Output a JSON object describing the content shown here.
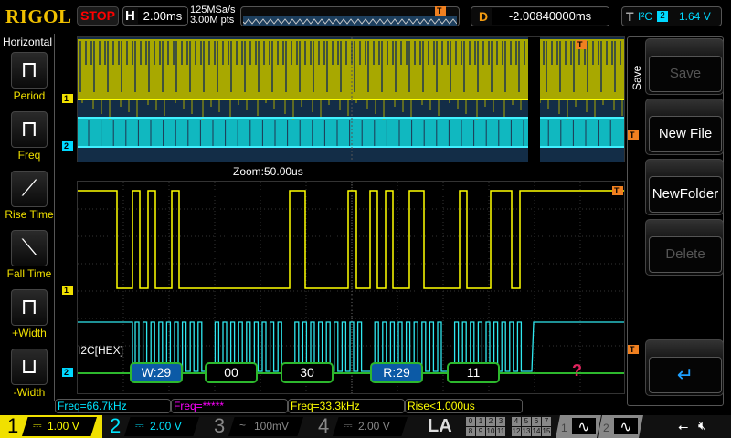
{
  "header": {
    "brand": "RIGOL",
    "run_state": "STOP",
    "timebase_key": "H",
    "timebase": "2.00ms",
    "sample_rate": "125MSa/s",
    "memory_depth": "3.00M pts",
    "delay_key": "D",
    "delay": "-2.00840000ms",
    "trigger_key": "T",
    "trigger_type": "I²C",
    "trigger_source": "2",
    "trigger_level": "1.64 V"
  },
  "left_panel": {
    "title": "Horizontal",
    "items": [
      {
        "label": "Period",
        "icon": "period-icon"
      },
      {
        "label": "Freq",
        "icon": "freq-icon"
      },
      {
        "label": "Rise Time",
        "icon": "rise-time-icon"
      },
      {
        "label": "Fall Time",
        "icon": "fall-time-icon"
      },
      {
        "label": "+Width",
        "icon": "pos-width-icon"
      },
      {
        "label": "-Width",
        "icon": "neg-width-icon"
      }
    ]
  },
  "display": {
    "zoom_label": "Zoom:50.00us",
    "ch1_marker": "1",
    "ch2_marker": "2",
    "trigger_marker": "T",
    "decode_label": "I2C[HEX]",
    "decode_packets": [
      {
        "text": "W:29",
        "type": "address"
      },
      {
        "text": "00",
        "type": "data"
      },
      {
        "text": "30",
        "type": "data"
      },
      {
        "text": "R:29",
        "type": "address"
      },
      {
        "text": "11",
        "type": "data"
      }
    ],
    "decode_error": "?"
  },
  "measurements": [
    {
      "text": "Freq=66.7kHz",
      "color": "#00e5ff"
    },
    {
      "text": "Freq=*****",
      "color": "#ff00ff"
    },
    {
      "text": "Freq=33.3kHz",
      "color": "#ffff00"
    },
    {
      "text": "Rise<1.000us",
      "color": "#ffff00"
    }
  ],
  "channels": [
    {
      "num": "1",
      "coupling": "⎓",
      "scale": "1.00 V",
      "color": "#ffff00"
    },
    {
      "num": "2",
      "coupling": "⎓",
      "scale": "2.00 V",
      "color": "#00e5ff"
    },
    {
      "num": "3",
      "coupling": "~",
      "scale": "100mV",
      "color": "#888888"
    },
    {
      "num": "4",
      "coupling": "⎓",
      "scale": "2.00 V",
      "color": "#888888"
    }
  ],
  "la": {
    "label": "LA",
    "row1": [
      "0",
      "1",
      "2",
      "3",
      "4",
      "5",
      "6",
      "7"
    ],
    "row2": [
      "8",
      "9",
      "10",
      "11",
      "12",
      "13",
      "14",
      "15"
    ]
  },
  "sources": [
    "1",
    "2"
  ],
  "menu": {
    "title": "Save",
    "buttons": [
      {
        "label": "Save",
        "enabled": false
      },
      {
        "label": "New File",
        "enabled": true
      },
      {
        "label": "NewFolder",
        "enabled": true
      },
      {
        "label": "Delete",
        "enabled": false
      }
    ],
    "back_icon": "return-arrow-icon"
  }
}
